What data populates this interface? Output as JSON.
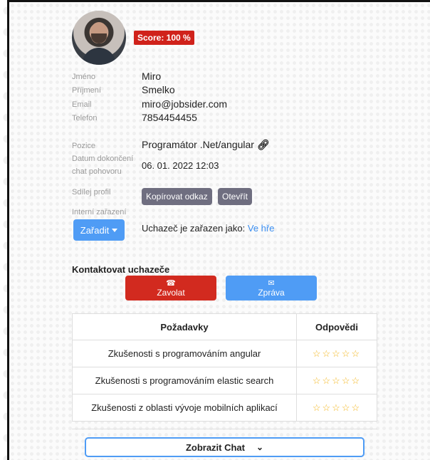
{
  "candidate": {
    "score": "Score: 100 %",
    "fields": [
      {
        "label": "Jméno",
        "value": "Miro"
      },
      {
        "label": "Příjmení",
        "value": "Smelko"
      },
      {
        "label": "Email",
        "value": "miro@jobsider.com"
      },
      {
        "label": "Telefon",
        "value": "7854454455"
      }
    ],
    "position_label": "Pozice",
    "position_value": "Programátor .Net/angular",
    "date_label_1": "Datum dokončení",
    "date_label_2": "chat pohovoru",
    "date_value": "06. 01. 2022 12:03",
    "share_label": "Sdílej profil",
    "copy_link": "Kopírovat odkaz",
    "open": "Otevřít",
    "internal_label": "Interní zařazení",
    "assign_button": "Zařadit",
    "assigned_text": "Uchazeč je zařazen jako:",
    "assigned_value": "Ve hře"
  },
  "contact": {
    "title": "Kontaktovat uchazeče",
    "call": "Zavolat",
    "message": "Zpráva"
  },
  "requirements": {
    "header_requirements": "Požadavky",
    "header_answers": "Odpovědi",
    "rows": [
      {
        "text": "Zkušenosti s programováním angular",
        "stars": "☆☆☆☆☆"
      },
      {
        "text": "Zkušenosti s programováním elastic search",
        "stars": "☆☆☆☆☆"
      },
      {
        "text": "Zkušenosti z oblasti vývoje mobilních aplikací",
        "stars": "☆☆☆☆☆"
      }
    ]
  },
  "chat": {
    "show_label": "Zobrazit Chat"
  },
  "icons": {
    "link": "link-icon",
    "phone": "phone-icon",
    "envelope": "envelope-icon",
    "chevron": "chevron-down-icon"
  }
}
